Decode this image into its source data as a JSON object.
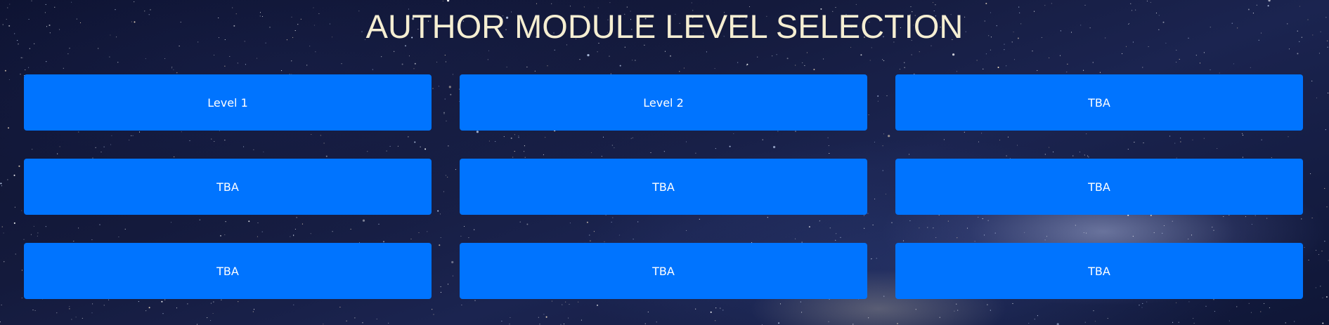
{
  "page": {
    "title": "AUTHOR MODULE LEVEL SELECTION"
  },
  "levels": [
    {
      "label": "Level 1"
    },
    {
      "label": "Level 2"
    },
    {
      "label": "TBA"
    },
    {
      "label": "TBA"
    },
    {
      "label": "TBA"
    },
    {
      "label": "TBA"
    },
    {
      "label": "TBA"
    },
    {
      "label": "TBA"
    },
    {
      "label": "TBA"
    }
  ],
  "colors": {
    "button_bg": "#0074ff",
    "button_text": "#ffffff",
    "title_text": "#f5eed2",
    "background": "#141a3c"
  }
}
